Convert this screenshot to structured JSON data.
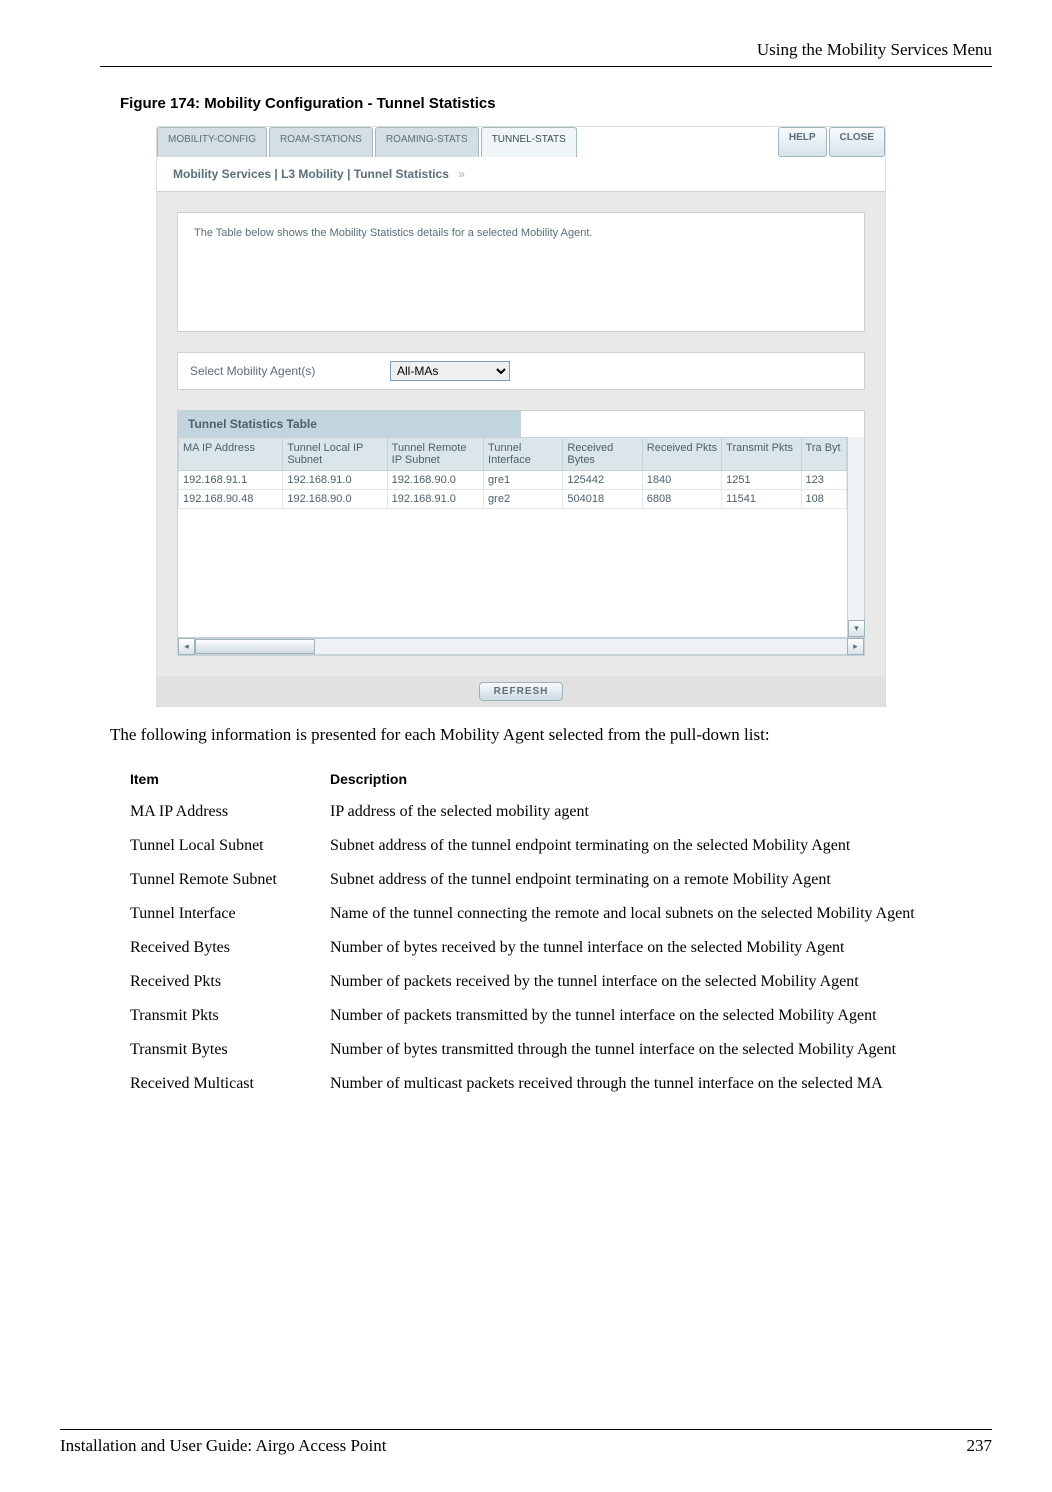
{
  "page_header": "Using the Mobility Services Menu",
  "figure_caption": "Figure 174:    Mobility Configuration - Tunnel Statistics",
  "screenshot": {
    "tabs": [
      "MOBILITY-CONFIG",
      "ROAM-STATIONS",
      "ROAMING-STATS",
      "TUNNEL-STATS"
    ],
    "active_tab_index": 3,
    "buttons": {
      "help": "HELP",
      "close": "CLOSE"
    },
    "breadcrumb": "Mobility Services | L3 Mobility | Tunnel Statistics",
    "info_text": "The Table below shows the Mobility Statistics details for a selected Mobility Agent.",
    "select_label": "Select Mobility Agent(s)",
    "select_value": "All-MAs",
    "table_title": "Tunnel Statistics Table",
    "columns": [
      "MA IP Address",
      "Tunnel Local IP Subnet",
      "Tunnel Remote IP Subnet",
      "Tunnel Interface",
      "Received Bytes",
      "Received Pkts",
      "Transmit Pkts",
      "Tra Byt"
    ],
    "rows": [
      [
        "192.168.91.1",
        "192.168.91.0",
        "192.168.90.0",
        "gre1",
        "125442",
        "1840",
        "1251",
        "123"
      ],
      [
        "192.168.90.48",
        "192.168.90.0",
        "192.168.91.0",
        "gre2",
        "504018",
        "6808",
        "11541",
        "108"
      ]
    ],
    "refresh_label": "REFRESH"
  },
  "after_text": "The following information is presented for each Mobility Agent selected from the pull-down list:",
  "desc_headers": {
    "item": "Item",
    "description": "Description"
  },
  "desc_rows": [
    {
      "item": "MA IP Address",
      "desc": "IP address of the selected mobility agent"
    },
    {
      "item": "Tunnel Local Subnet",
      "desc": "Subnet address of the tunnel endpoint terminating on the selected Mobility Agent"
    },
    {
      "item": "Tunnel Remote Subnet",
      "desc": "Subnet address of the tunnel endpoint terminating on a remote Mobility Agent"
    },
    {
      "item": "Tunnel Interface",
      "desc": "Name of the tunnel connecting the remote and local subnets on the selected Mobility Agent"
    },
    {
      "item": "Received Bytes",
      "desc": "Number of bytes received by the tunnel interface on the selected Mobility Agent"
    },
    {
      "item": "Received Pkts",
      "desc": "Number of packets received by the tunnel interface on the selected Mobility Agent"
    },
    {
      "item": "Transmit Pkts",
      "desc": "Number of packets transmitted by the tunnel interface on the selected Mobility Agent"
    },
    {
      "item": "Transmit Bytes",
      "desc": "Number of bytes transmitted through the tunnel interface on the selected Mobility Agent"
    },
    {
      "item": "Received Multicast",
      "desc": "Number of multicast packets received through the tunnel interface on the selected MA"
    }
  ],
  "footer": {
    "left": "Installation and User Guide: Airgo Access Point",
    "right": "237"
  }
}
